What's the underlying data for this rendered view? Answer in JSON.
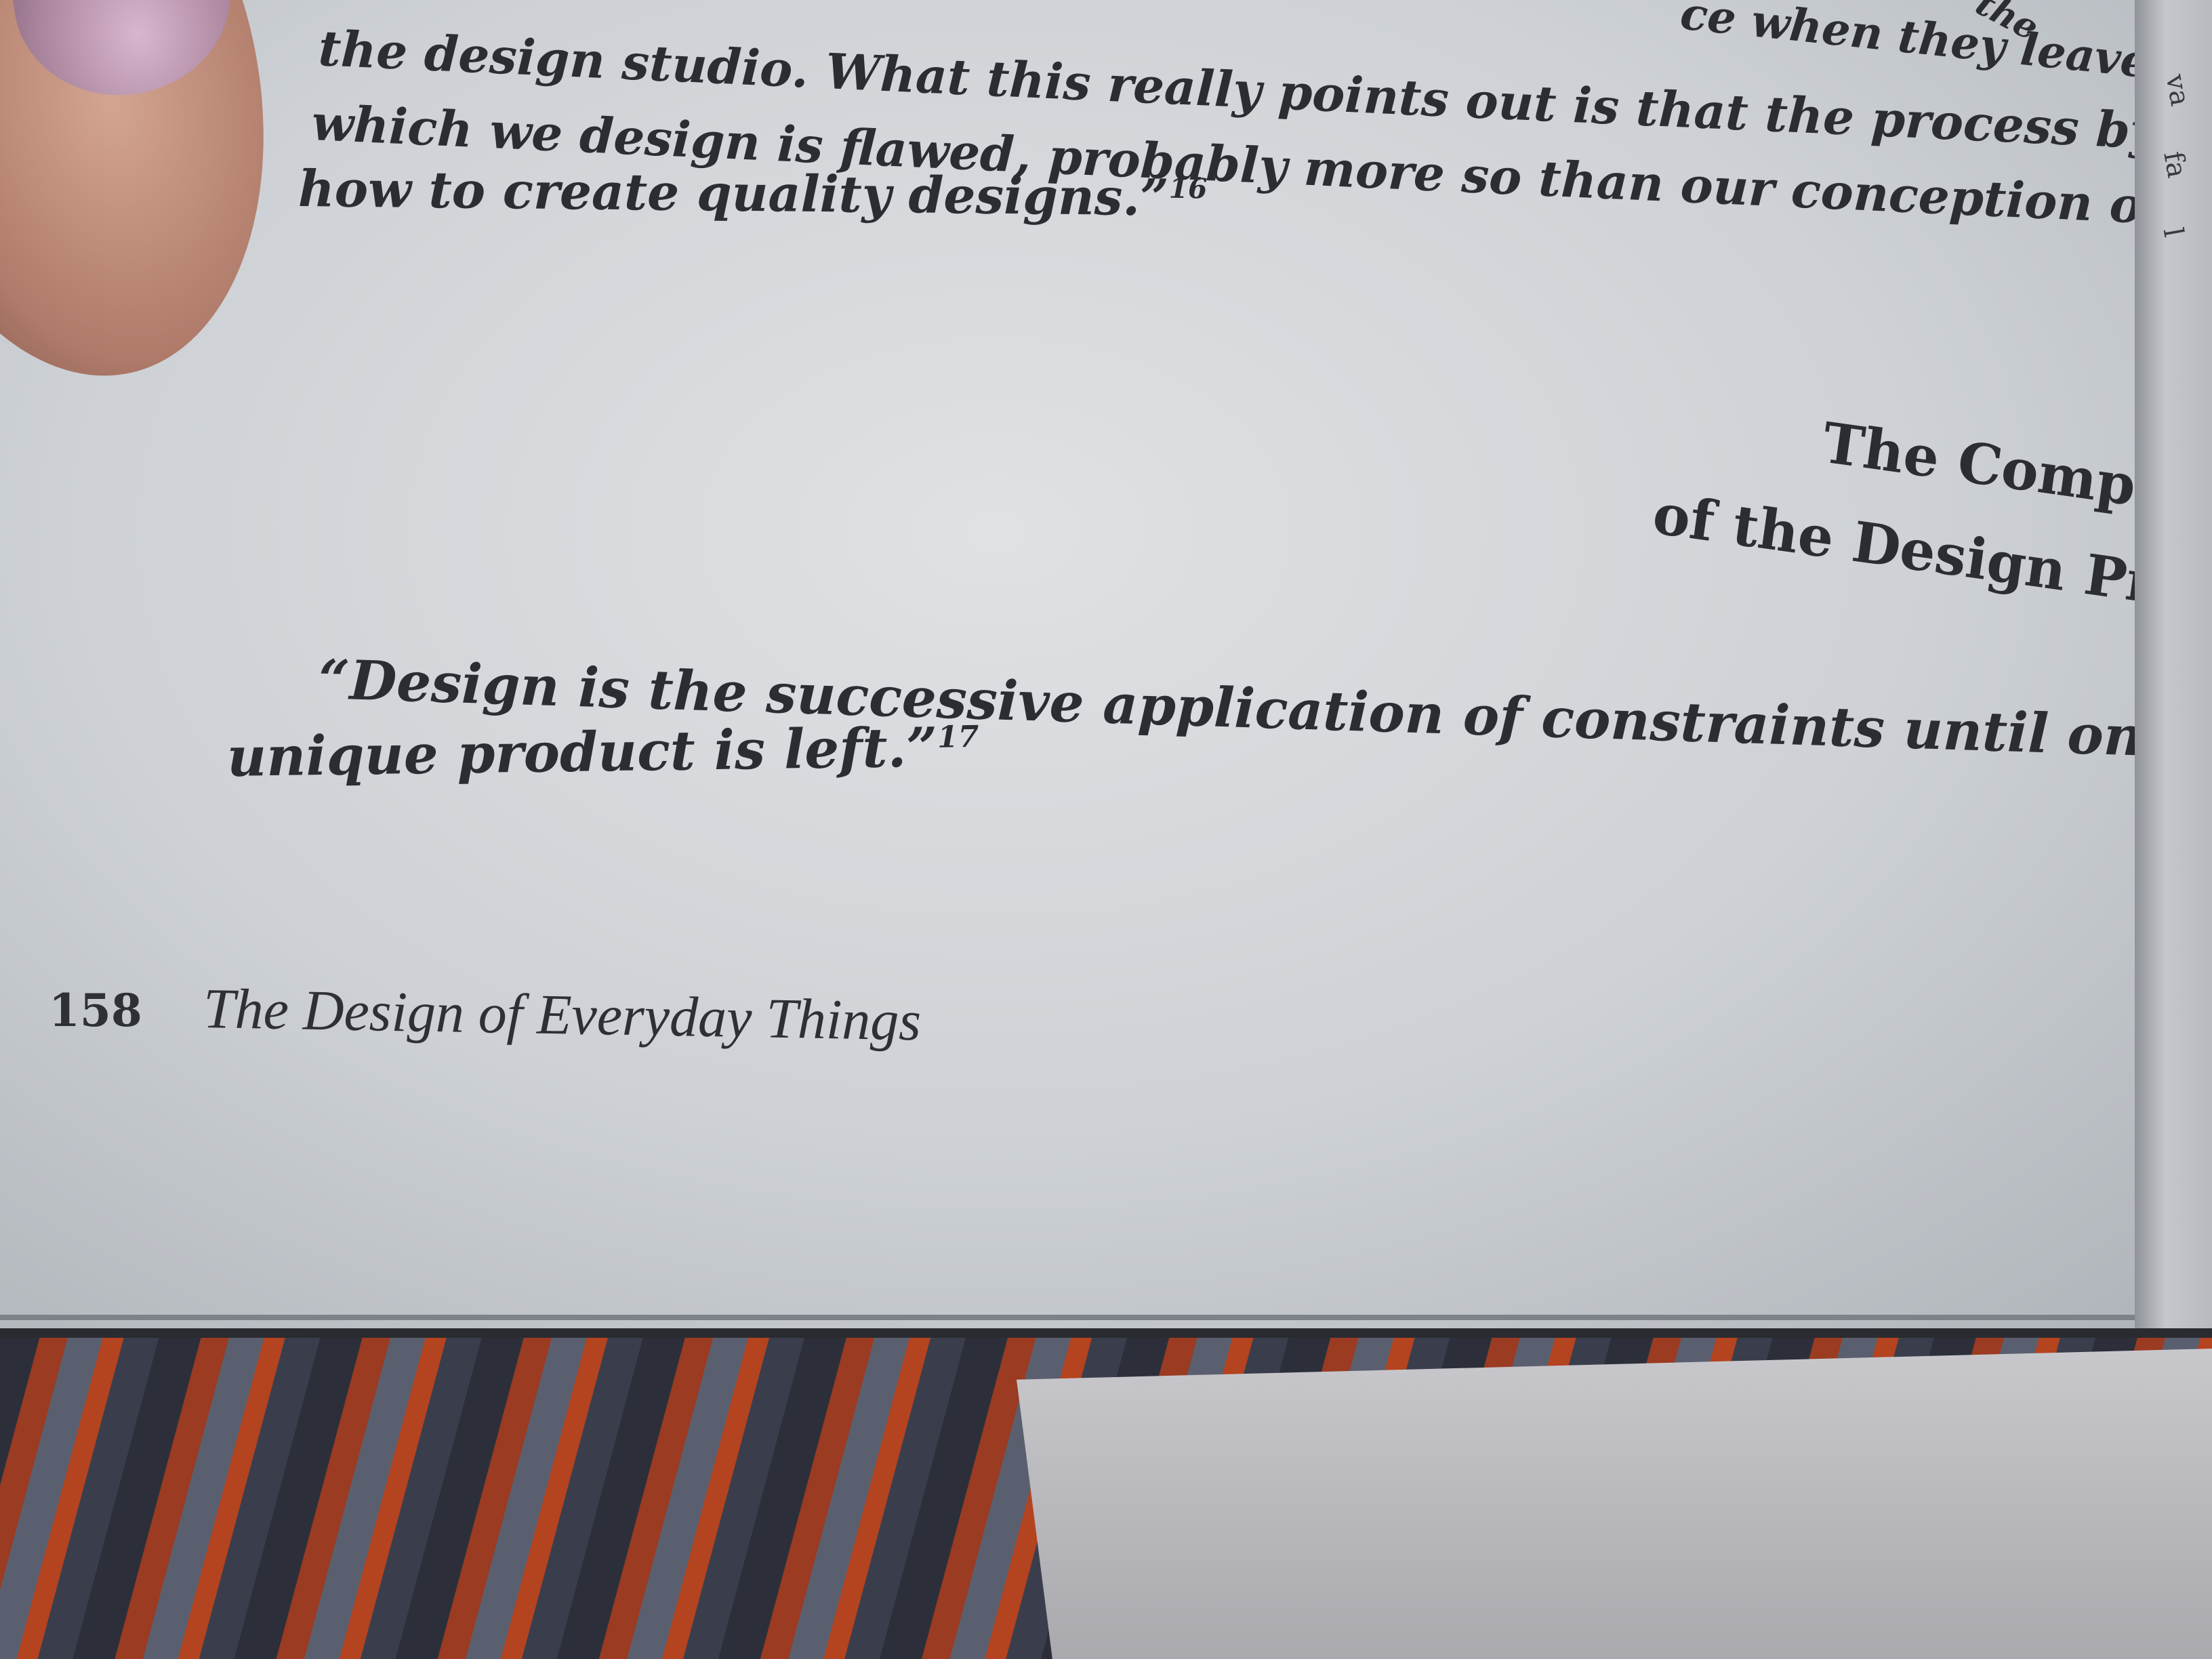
{
  "top_passage": {
    "fragment_right": "ce when they leave",
    "fragment_corner": "the",
    "line1": "the design studio. What this really points out is that the process by",
    "line2": "which we design is flawed, probably more so than our conception of",
    "line3": "how to create quality designs.”",
    "line3_note": "16"
  },
  "section_heading": {
    "line1": "The Complexity",
    "line2": "of the Design Process"
  },
  "quote": {
    "line1": "“Design is the successive application of constraints until only a",
    "line2": "unique product is left.”",
    "note": "17"
  },
  "footer": {
    "page_number": "158",
    "book_title": "The Design of Everyday Things"
  },
  "facing_page_fragments": [
    "va",
    "fa",
    "l"
  ]
}
